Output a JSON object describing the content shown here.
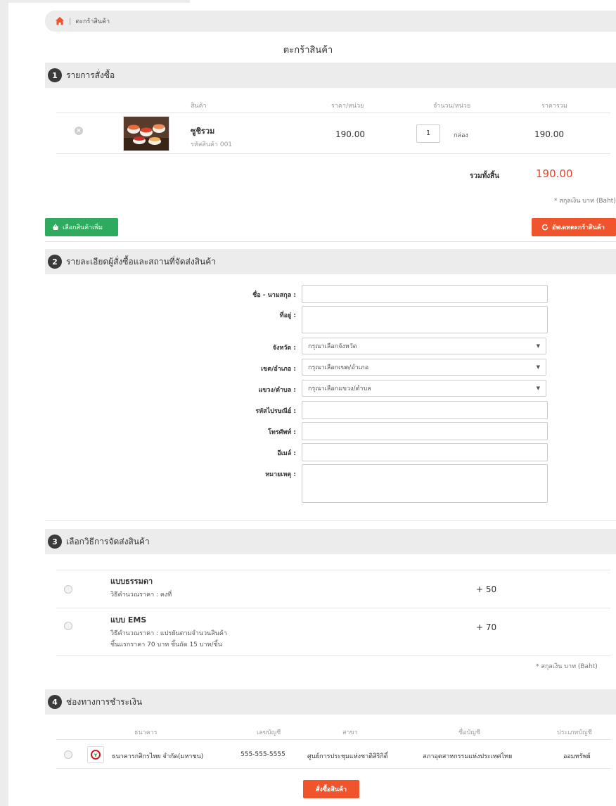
{
  "breadcrumb": {
    "separator": "|",
    "current": "ตะกร้าสินค้า"
  },
  "page_title": "ตะกร้าสินค้า",
  "section1": {
    "number": "1",
    "title": "รายการสั่งซื้อ",
    "headers": {
      "product": "สินค้า",
      "unit_price": "ราคา/หน่วย",
      "qty_unit": "จำนวน/หน่วย",
      "total": "ราคารวม"
    },
    "item": {
      "name": "ซูชิรวม",
      "code": "รหัสสินค้า 001",
      "price": "190.00",
      "qty": "1",
      "unit": "กล่อง",
      "total": "190.00"
    },
    "grand_total_label": "รวมทั้งสิ้น",
    "grand_total": "190.00",
    "currency_note": "* สกุลเงิน บาท (Baht)"
  },
  "buttons": {
    "continue_shopping": "เลือกสินค้าเพิ่ม",
    "update_cart": "อัพเดทตะกร้าสินค้า",
    "checkout": "สั่งซื้อสินค้า"
  },
  "section2": {
    "number": "2",
    "title": "รายละเอียดผู้สั่งซื้อและสถานที่จัดส่งสินค้า",
    "labels": {
      "name": "ชื่อ - นามสกุล :",
      "address": "ที่อยู่ :",
      "province": "จังหวัด :",
      "district": "เขต/อำเภอ :",
      "subdistrict": "แขวง/ตำบล :",
      "postcode": "รหัสไปรษณีย์ :",
      "phone": "โทรศัพท์ :",
      "email": "อีเมล์ :",
      "note": "หมายเหตุ :"
    },
    "selects": {
      "province": "กรุณาเลือกจังหวัด",
      "district": "กรุณาเลือกเขต/อำเภอ",
      "subdistrict": "กรุณาเลือกแขวง/ตำบล"
    }
  },
  "section3": {
    "number": "3",
    "title": "เลือกวิธีการจัดส่งสินค้า",
    "options": [
      {
        "name": "แบบธรรมดา",
        "desc1": "วิธีคำนวณราคา : คงที่",
        "desc2": "",
        "price": "+ 50"
      },
      {
        "name": "แบบ EMS",
        "desc1": "วิธีคำนวณราคา : แปรผันตามจำนวนสินค้า",
        "desc2": "ชิ้นแรกราคา 70 บาท ชิ้นถัด 15 บาท/ชิ้น",
        "price": "+ 70"
      }
    ],
    "currency_note": "* สกุลเงิน บาท (Baht)"
  },
  "section4": {
    "number": "4",
    "title": "ช่องทางการชำระเงิน",
    "headers": {
      "bank": "ธนาคาร",
      "account_no": "เลขบัญชี",
      "branch": "สาขา",
      "account_name": "ชื่อบัญชี",
      "account_type": "ประเภทบัญชี"
    },
    "row": {
      "bank": "ธนาคารกสิกรไทย จำกัด(มหาชน)",
      "account_no": "555-555-5555",
      "branch": "ศูนย์การประชุมแห่งชาติสิริกิติ์",
      "account_name": "สภาอุตสาหกรรมแห่งประเทศไทย",
      "account_type": "ออมทรัพย์"
    }
  },
  "colors": {
    "accent_orange": "#f0542c",
    "accent_green": "#2eab5f",
    "total_red": "#e8432c",
    "section_bg": "#ececec",
    "bank_red": "#c91f1f"
  },
  "icons": [
    "home-icon",
    "remove-icon",
    "basket-icon",
    "refresh-icon",
    "dropdown-caret-icon",
    "radio-icon",
    "bank-logo-icon"
  ]
}
